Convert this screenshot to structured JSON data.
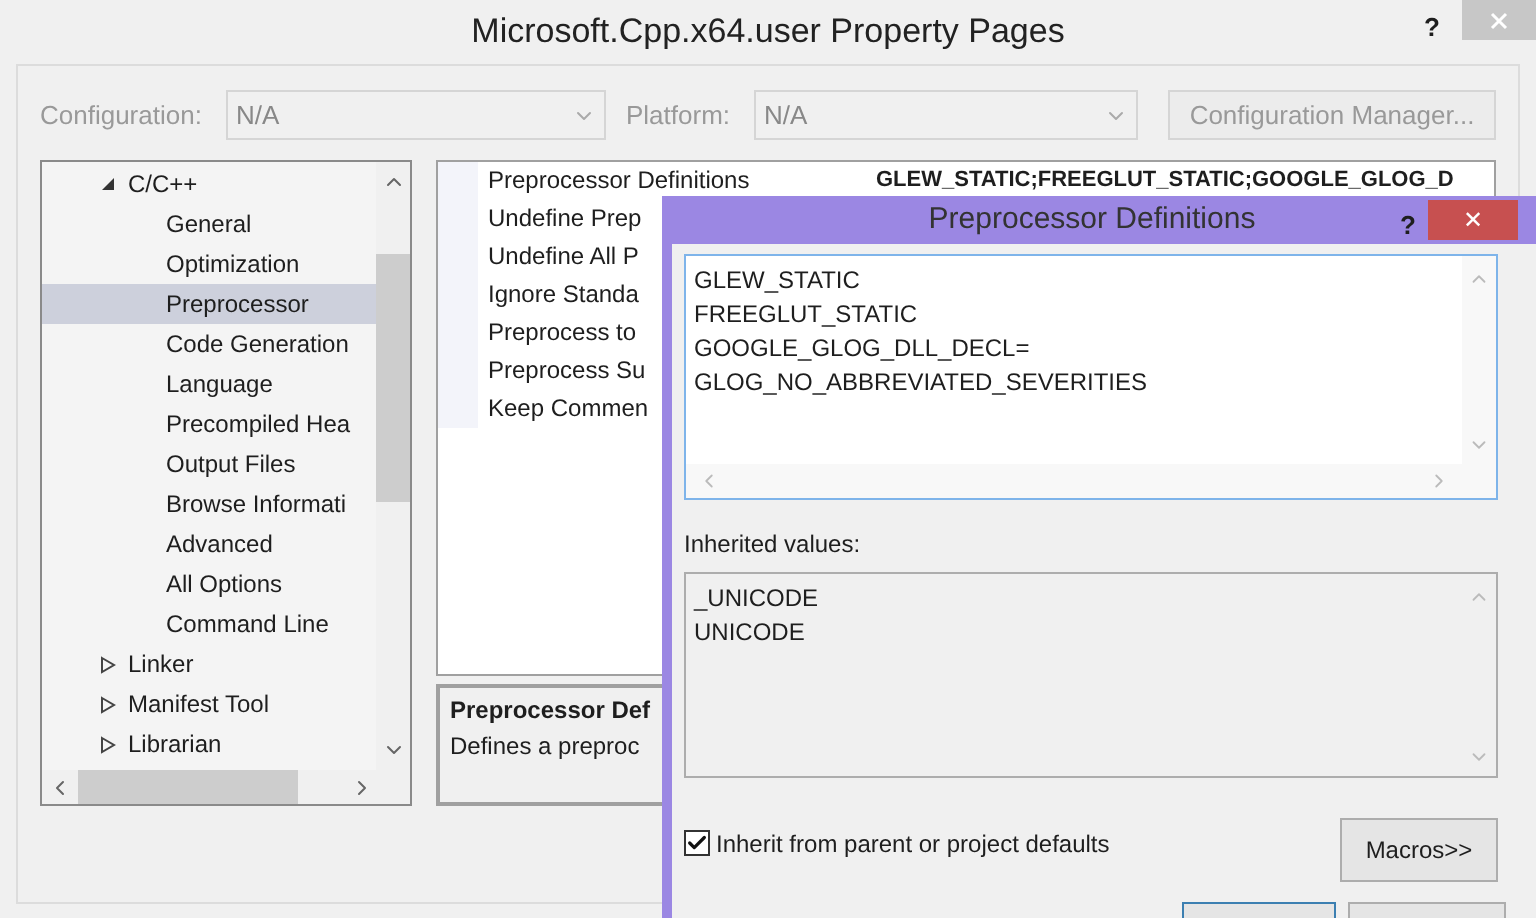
{
  "window": {
    "title": "Microsoft.Cpp.x64.user Property Pages",
    "help": "?"
  },
  "config_bar": {
    "configuration_label": "Configuration:",
    "configuration_value": "N/A",
    "platform_label": "Platform:",
    "platform_value": "N/A",
    "manager_button": "Configuration Manager..."
  },
  "tree": [
    {
      "label": "C/C++",
      "expanded": true,
      "selected": false,
      "children": [
        {
          "label": "General",
          "selected": false
        },
        {
          "label": "Optimization",
          "selected": false
        },
        {
          "label": "Preprocessor",
          "selected": true
        },
        {
          "label": "Code Generation",
          "selected": false
        },
        {
          "label": "Language",
          "selected": false
        },
        {
          "label": "Precompiled Hea",
          "selected": false
        },
        {
          "label": "Output Files",
          "selected": false
        },
        {
          "label": "Browse Informati",
          "selected": false
        },
        {
          "label": "Advanced",
          "selected": false
        },
        {
          "label": "All Options",
          "selected": false
        },
        {
          "label": "Command Line",
          "selected": false
        }
      ]
    },
    {
      "label": "Linker",
      "expanded": false,
      "selected": false
    },
    {
      "label": "Manifest Tool",
      "expanded": false,
      "selected": false
    },
    {
      "label": "Librarian",
      "expanded": false,
      "selected": false
    }
  ],
  "properties": [
    {
      "name": "Preprocessor Definitions",
      "value": "GLEW_STATIC;FREEGLUT_STATIC;GOOGLE_GLOG_D"
    },
    {
      "name": "Undefine Prep"
    },
    {
      "name": "Undefine All P"
    },
    {
      "name": "Ignore Standa"
    },
    {
      "name": "Preprocess to"
    },
    {
      "name": "Preprocess Su"
    },
    {
      "name": "Keep Commen"
    }
  ],
  "description": {
    "title": "Preprocessor Def",
    "text": "Defines a preproc"
  },
  "dialog": {
    "title": "Preprocessor Definitions",
    "help": "?",
    "close": "✕",
    "definitions": [
      "GLEW_STATIC",
      "FREEGLUT_STATIC",
      "GOOGLE_GLOG_DLL_DECL=",
      "GLOG_NO_ABBREVIATED_SEVERITIES"
    ],
    "inherited_label": "Inherited values:",
    "inherited": [
      "_UNICODE",
      "UNICODE"
    ],
    "inherit_checkbox": {
      "label": "Inherit from parent or project defaults",
      "checked": true
    },
    "macros_button": "Macros>>"
  }
}
